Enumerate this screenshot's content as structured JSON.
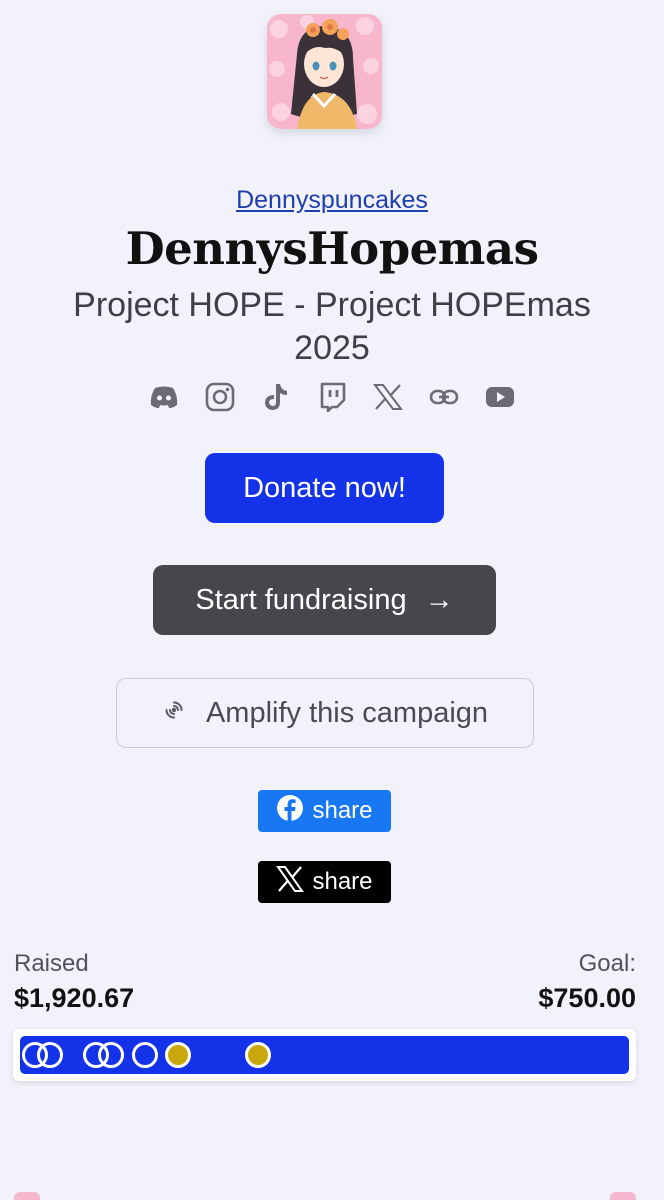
{
  "campaign": {
    "streamer": "Dennyspuncakes",
    "title": "DennysHopemas",
    "subtitle": "Project HOPE - Project HOPEmas 2025"
  },
  "socials": [
    {
      "icon": "discord-icon"
    },
    {
      "icon": "instagram-icon"
    },
    {
      "icon": "tiktok-icon"
    },
    {
      "icon": "twitch-icon"
    },
    {
      "icon": "x-icon"
    },
    {
      "icon": "link-icon"
    },
    {
      "icon": "youtube-icon"
    }
  ],
  "actions": {
    "donate": "Donate now!",
    "start": "Start fundraising",
    "start_arrow": "→",
    "amplify": "Amplify this campaign"
  },
  "share": {
    "facebook": "share",
    "x": "share"
  },
  "stats": {
    "raised_label": "Raised",
    "raised_value": "$1,920.67",
    "goal_label": "Goal:",
    "goal_value": "$750.00",
    "progress_fraction": 1.0
  },
  "milestones": [
    {
      "fraction": 0.025,
      "reached": true,
      "style": "ring"
    },
    {
      "fraction": 0.05,
      "reached": true,
      "style": "ring"
    },
    {
      "fraction": 0.125,
      "reached": true,
      "style": "ring"
    },
    {
      "fraction": 0.15,
      "reached": true,
      "style": "ring"
    },
    {
      "fraction": 0.205,
      "reached": true,
      "style": "ring"
    },
    {
      "fraction": 0.26,
      "reached": true,
      "style": "gold"
    },
    {
      "fraction": 0.39,
      "reached": true,
      "style": "gold"
    }
  ],
  "colors": {
    "accent": "#1433e8",
    "secondary_button": "#46464c",
    "facebook": "#1877f2",
    "x": "#000000",
    "milestone_gold": "#c9a80e",
    "background": "#f2f2fb"
  }
}
